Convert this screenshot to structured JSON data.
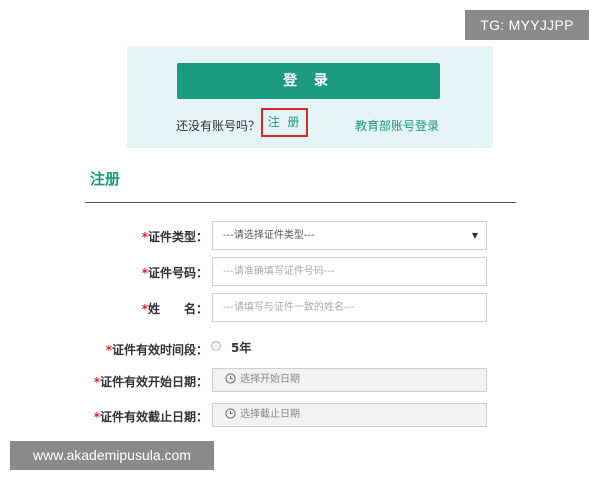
{
  "watermarks": {
    "top_right": "TG: MYYJJPP",
    "bottom_left": "www.akademipusula.com"
  },
  "login": {
    "button_label": "登 录",
    "no_account_text": "还没有账号吗？",
    "register_link": "注 册",
    "edu_login_link": "教育部账号登录"
  },
  "register": {
    "title": "注册",
    "fields": {
      "id_type": {
        "required": "*",
        "label": "证件类型：",
        "value": "---请选择证件类型---"
      },
      "id_number": {
        "required": "*",
        "label": "证件号码：",
        "placeholder": "---请准确填写证件号码---"
      },
      "name": {
        "required": "*",
        "label_a": "姓",
        "label_b": "名：",
        "placeholder": "---请填写与证件一致的姓名---"
      },
      "validity": {
        "required": "*",
        "label": "证件有效时间段：",
        "option": "5年"
      },
      "start_date": {
        "required": "*",
        "label": "证件有效开始日期：",
        "placeholder": "选择开始日期"
      },
      "end_date": {
        "required": "*",
        "label": "证件有效截止日期：",
        "placeholder": "选择截止日期"
      }
    }
  },
  "colors": {
    "brand_green": "#1b9a7e",
    "highlight_red": "#d9262b",
    "panel_bg": "#e4f3f6"
  },
  "icons": {
    "select_arrow": "caret-down-icon",
    "date_picker": "clock-icon",
    "radio": "radio-unchecked-icon"
  }
}
